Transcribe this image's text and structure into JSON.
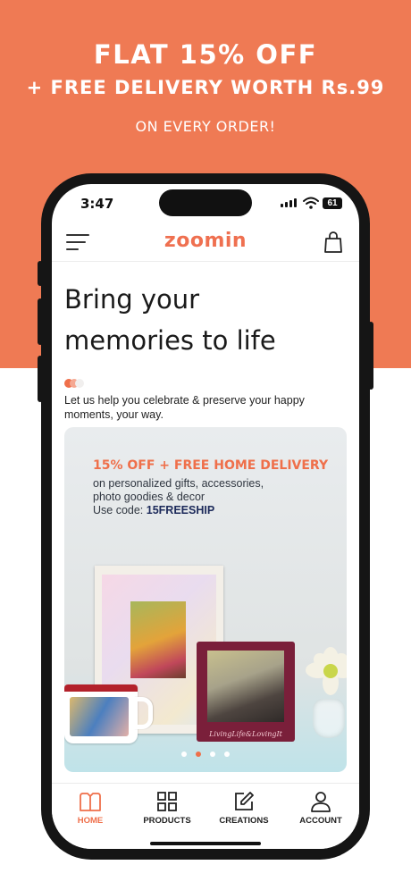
{
  "promo": {
    "line1": "FLAT 15% OFF",
    "line2": "+ FREE DELIVERY WORTH Rs.99",
    "line3": "ON EVERY ORDER!",
    "bg_color": "#ef7a54"
  },
  "status_bar": {
    "time": "3:47",
    "battery": "61"
  },
  "app_bar": {
    "logo": "zoomin",
    "menu_icon": "hamburger-menu-icon",
    "cart_icon": "shopping-bag-icon"
  },
  "hero": {
    "title_line1": "Bring your",
    "title_line2": "memories to life",
    "tagline": "Let us help you celebrate & preserve your happy moments, your way."
  },
  "banner": {
    "title": "15% OFF + FREE HOME DELIVERY",
    "subtitle_line1": "on personalized gifts, accessories,",
    "subtitle_line2": "photo goodies & decor",
    "code_prefix": "Use code:",
    "code": "15FREESHIP",
    "frame_text": "LivingLife&LovingIt",
    "carousel_total": 4,
    "carousel_active": 2
  },
  "tabs": [
    {
      "label": "HOME",
      "icon": "home-icon",
      "active": true
    },
    {
      "label": "PRODUCTS",
      "icon": "grid-icon",
      "active": false
    },
    {
      "label": "CREATIONS",
      "icon": "edit-icon",
      "active": false
    },
    {
      "label": "ACCOUNT",
      "icon": "user-icon",
      "active": false
    }
  ],
  "colors": {
    "accent": "#ef6f4a",
    "code": "#1c2a5a"
  }
}
